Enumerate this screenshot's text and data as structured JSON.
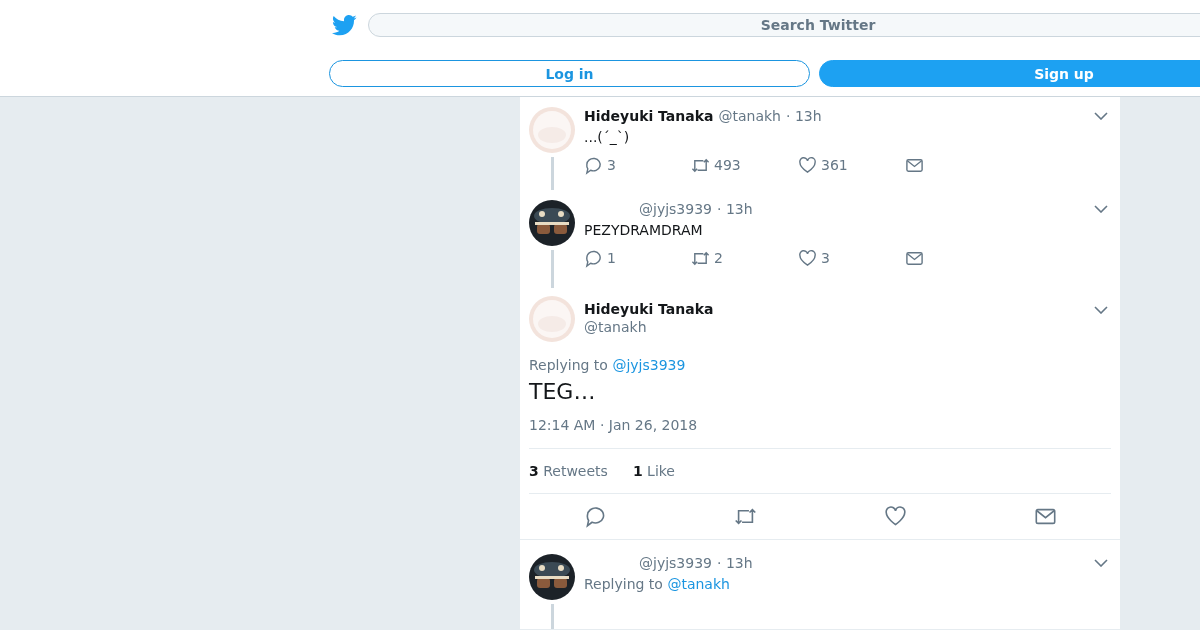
{
  "header": {
    "search": {
      "placeholder": "Search Twitter"
    },
    "buttons": [
      {
        "label": "Log in",
        "kind": "outline"
      },
      {
        "label": "Sign up",
        "kind": "filled"
      }
    ]
  },
  "tweets": [
    {
      "kind": "compact",
      "name": "Hideyuki Tanaka",
      "handle": "@tanakh",
      "time": "· 13h",
      "text": "...(´_`)",
      "replies": "3",
      "retweets": "493",
      "likes": "361",
      "thread_below": true
    },
    {
      "kind": "compact",
      "handle": "@jyjs3939",
      "time": "· 13h",
      "text": "PEZYDRAMDRAM",
      "replies": "1",
      "retweets": "2",
      "likes": "3",
      "thread_below": true
    },
    {
      "kind": "focus",
      "name": "Hideyuki Tanaka",
      "handle": "@tanakh",
      "replying_label": "Replying to",
      "replying_to": "@jyjs3939",
      "text": "TEG…",
      "timestamp": "12:14 AM · Jan 26, 2018",
      "retweet_count": "3",
      "retweet_label": "Retweets",
      "like_count": "1",
      "like_label": "Like"
    },
    {
      "kind": "cut",
      "handle": "@jyjs3939",
      "time": "· 13h",
      "replying_label": "Replying to",
      "replying_to": "@tanakh",
      "thread_below": true
    }
  ]
}
